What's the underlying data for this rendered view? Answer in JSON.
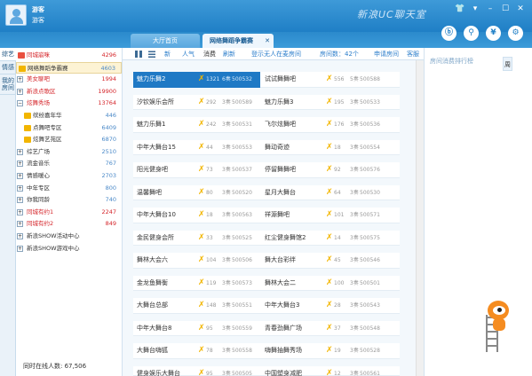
{
  "app": {
    "brand": "新浪UC聊天室",
    "user_name": "游客",
    "user_level": "游客"
  },
  "window_buttons": [
    "👕",
    "▾",
    "–",
    "☐",
    "✕"
  ],
  "tabs": {
    "lobby": "大厅首页",
    "active": "网络舞蹈争霸赛",
    "close_glyph": "✕"
  },
  "tool_icons": [
    "ⓑ",
    "⚲",
    "¥",
    "⚙"
  ],
  "leftnav": {
    "tabs": [
      "综艺",
      "情感",
      "我的房间"
    ]
  },
  "tree": {
    "rows": [
      {
        "label": "同城崩咪",
        "count": "4296"
      },
      {
        "label": "网络舞蹈争霸赛",
        "count": "4603"
      },
      {
        "label": "美女聊吧",
        "count": "1994"
      },
      {
        "label": "新浪点歌区",
        "count": "19900"
      },
      {
        "label": "炫舞秀场",
        "count": "13764"
      },
      {
        "label": "缤纷嘉年华",
        "count": "446"
      },
      {
        "label": "点舞吧专区",
        "count": "6409"
      },
      {
        "label": "炫舞艺苑区",
        "count": "6870"
      },
      {
        "label": "综艺广场",
        "count": "2510"
      },
      {
        "label": "流金音乐",
        "count": "767"
      },
      {
        "label": "情感暖心",
        "count": "2703"
      },
      {
        "label": "中年专区",
        "count": "800"
      },
      {
        "label": "你我同龄",
        "count": "740"
      },
      {
        "label": "同城有约1",
        "count": "2247"
      },
      {
        "label": "同城有约2",
        "count": "849"
      },
      {
        "label": "新浪SHOW活动中心",
        "count": ""
      },
      {
        "label": "新浪SHOW游戏中心",
        "count": ""
      }
    ],
    "footer": "同时在线人数: 67,506"
  },
  "main": {
    "sort": {
      "new": "新",
      "hot": "人气",
      "consume": "消费",
      "refresh": "刷新",
      "login_link": "登示无人在麦房间",
      "room_count": "房间数：42个",
      "apply": "申请房间",
      "service": "客服"
    },
    "rooms": [
      {
        "name": "魅力乐舞2",
        "num": "1321",
        "star": "6奏",
        "id": "500532"
      },
      {
        "name": "试试舞舞吧",
        "num": "556",
        "star": "5奏",
        "id": "500588"
      },
      {
        "name": "汐钦娱乐会所",
        "num": "292",
        "star": "3奏",
        "id": "500589"
      },
      {
        "name": "魅力乐舞3",
        "num": "195",
        "star": "3奏",
        "id": "500533"
      },
      {
        "name": "魅力乐舞1",
        "num": "242",
        "star": "3奏",
        "id": "500531"
      },
      {
        "name": "飞尔炫舞吧",
        "num": "176",
        "star": "3奏",
        "id": "500536"
      },
      {
        "name": "中年大舞台15",
        "num": "44",
        "star": "3奏",
        "id": "500553"
      },
      {
        "name": "舞动奇迹",
        "num": "18",
        "star": "3奏",
        "id": "500554"
      },
      {
        "name": "阳光健身吧",
        "num": "73",
        "star": "3奏",
        "id": "500537"
      },
      {
        "name": "停留舞舞吧",
        "num": "92",
        "star": "3奏",
        "id": "500576"
      },
      {
        "name": "温馨舞吧",
        "num": "80",
        "star": "3奏",
        "id": "500520"
      },
      {
        "name": "星月大舞台",
        "num": "64",
        "star": "3奏",
        "id": "500530"
      },
      {
        "name": "中年大舞台10",
        "num": "18",
        "star": "3奏",
        "id": "500563"
      },
      {
        "name": "祥源舞吧",
        "num": "101",
        "star": "3奏",
        "id": "500571"
      },
      {
        "name": "金民健身会所",
        "num": "33",
        "star": "3奏",
        "id": "500525"
      },
      {
        "name": "红尘健身舞馆2",
        "num": "14",
        "star": "3奏",
        "id": "500575"
      },
      {
        "name": "舞林大会六",
        "num": "104",
        "star": "3奏",
        "id": "500506"
      },
      {
        "name": "舞大台彩绊",
        "num": "45",
        "star": "3奏",
        "id": "500546"
      },
      {
        "name": "金龙鱼舞衡",
        "num": "119",
        "star": "3奏",
        "id": "500573"
      },
      {
        "name": "舞林大会二",
        "num": "100",
        "star": "3奏",
        "id": "500501"
      },
      {
        "name": "大舞台总部",
        "num": "148",
        "star": "3奏",
        "id": "500551"
      },
      {
        "name": "中年大舞台3",
        "num": "28",
        "star": "3奏",
        "id": "500543"
      },
      {
        "name": "中年大舞台8",
        "num": "95",
        "star": "3奏",
        "id": "500559"
      },
      {
        "name": "青春劲舞广场",
        "num": "37",
        "star": "3奏",
        "id": "500548"
      },
      {
        "name": "大舞台嗨狐",
        "num": "78",
        "star": "3奏",
        "id": "500558"
      },
      {
        "name": "嗨舞抽舞秀场",
        "num": "19",
        "star": "3奏",
        "id": "500528"
      },
      {
        "name": "健身娱乐大舞台",
        "num": "95",
        "star": "3奏",
        "id": "500505"
      },
      {
        "name": "中国塑身减肥",
        "num": "12",
        "star": "3奏",
        "id": "500561"
      }
    ]
  },
  "right": {
    "rank_title": "房间消费排行榜",
    "rank_tab": "周"
  },
  "colors": {
    "titlebar": "#2a8bd0",
    "selected_room": "#1f79c5",
    "red_text": "#d5262b",
    "gold_icon": "#f2b500"
  }
}
